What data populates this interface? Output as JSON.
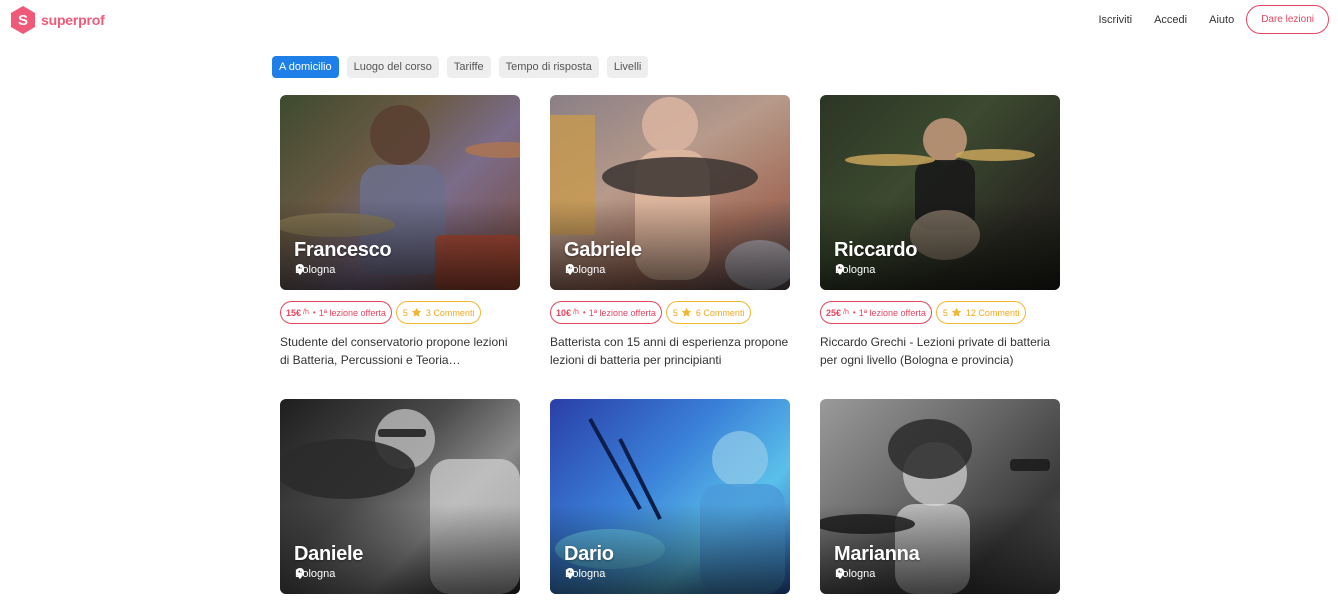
{
  "header": {
    "logo_letter": "S",
    "logo_text": "superprof",
    "nav": [
      "Iscriviti",
      "Accedi",
      "Aiuto"
    ],
    "cta": "Dare lezioni",
    "brand_color": "#f05a78"
  },
  "filters": {
    "tabs": [
      "A domicilio",
      "Luogo del corso",
      "Tariffe",
      "Tempo di risposta",
      "Livelli"
    ],
    "active_index": 0,
    "active_color": "#1f7fe8"
  },
  "teachers": [
    {
      "name": "Francesco",
      "location": "Bologna",
      "price": "15€",
      "per": "/h",
      "offer": "1ª lezione offerta",
      "rating": "5",
      "comments": "3 Commenti",
      "description": "Studente del conservatorio propone lezioni di Batteria, Percussioni e Teoria…"
    },
    {
      "name": "Gabriele",
      "location": "Bologna",
      "price": "10€",
      "per": "/h",
      "offer": "1ª lezione offerta",
      "rating": "5",
      "comments": "6 Commenti",
      "description": "Batterista con 15 anni di esperienza propone lezioni di batteria per principianti"
    },
    {
      "name": "Riccardo",
      "location": "Bologna",
      "price": "25€",
      "per": "/h",
      "offer": "1ª lezione offerta",
      "rating": "5",
      "comments": "12 Commenti",
      "description": "Riccardo Grechi - Lezioni private di batteria per ogni livello (Bologna e provincia)"
    },
    {
      "name": "Daniele",
      "location": "Bologna"
    },
    {
      "name": "Dario",
      "location": "Bologna"
    },
    {
      "name": "Marianna",
      "location": "Bologna"
    }
  ],
  "icons": {
    "location": "map-pin-icon",
    "rating": "star-icon"
  },
  "colors": {
    "price": "#e8455f",
    "rating": "#f2b730"
  }
}
